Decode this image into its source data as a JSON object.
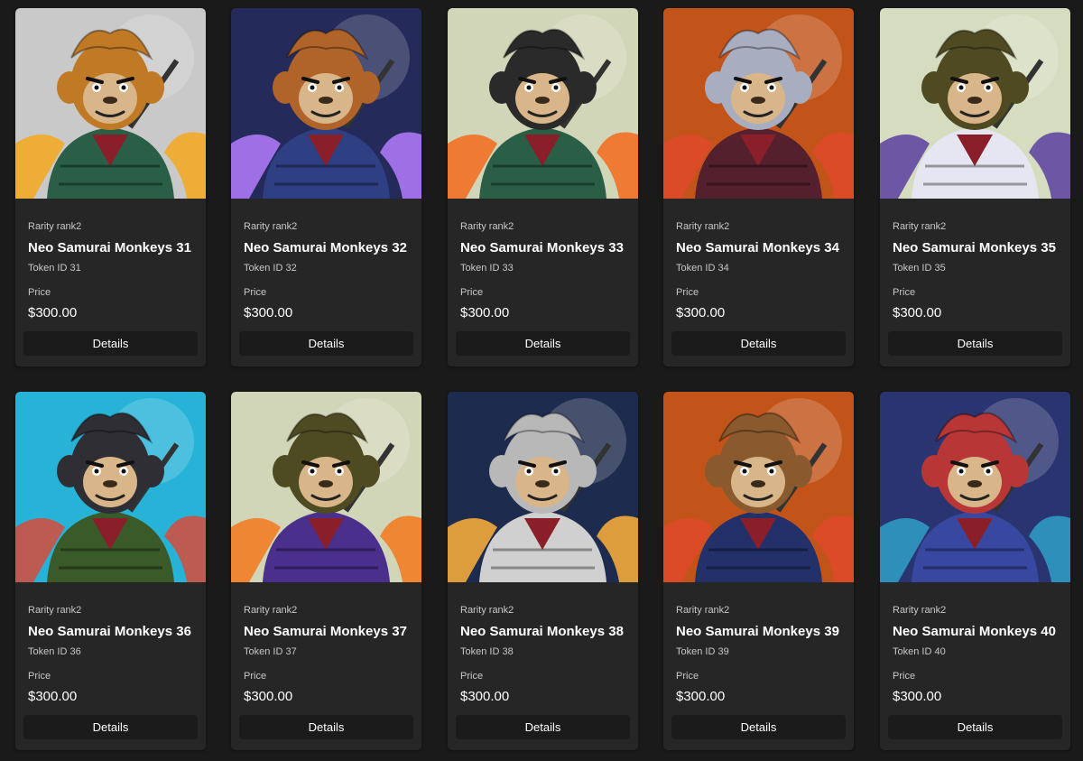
{
  "rarity_label": "Rarity rank2",
  "price_label": "Price",
  "details_label": "Details",
  "cards": [
    {
      "name": "Neo Samurai Monkeys 31",
      "token": "Token ID 31",
      "price": "$300.00",
      "bg": "#c9c9c9",
      "fur": "#c07a25",
      "outfit": "#2a5e46",
      "accent": "#f3a81c"
    },
    {
      "name": "Neo Samurai Monkeys 32",
      "token": "Token ID 32",
      "price": "$300.00",
      "bg": "#242a5a",
      "fur": "#b0642a",
      "outfit": "#2f3f83",
      "accent": "#b57bff"
    },
    {
      "name": "Neo Samurai Monkeys 33",
      "token": "Token ID 33",
      "price": "$300.00",
      "bg": "#d2d6b8",
      "fur": "#2a2a2a",
      "outfit": "#2a5e46",
      "accent": "#f36a1c"
    },
    {
      "name": "Neo Samurai Monkeys 34",
      "token": "Token ID 34",
      "price": "$300.00",
      "bg": "#c2541a",
      "fur": "#a9adc0",
      "outfit": "#55202e",
      "accent": "#e04a2a"
    },
    {
      "name": "Neo Samurai Monkeys 35",
      "token": "Token ID 35",
      "price": "$300.00",
      "bg": "#d6dcc0",
      "fur": "#4f4a22",
      "outfit": "#e6e6f2",
      "accent": "#5b3fa0"
    },
    {
      "name": "Neo Samurai Monkeys 36",
      "token": "Token ID 36",
      "price": "$300.00",
      "bg": "#27b3d8",
      "fur": "#2e2e34",
      "outfit": "#3b5a2a",
      "accent": "#d84a3a"
    },
    {
      "name": "Neo Samurai Monkeys 37",
      "token": "Token ID 37",
      "price": "$300.00",
      "bg": "#d2d6b8",
      "fur": "#4e4a22",
      "outfit": "#4a2f8c",
      "accent": "#f3781c"
    },
    {
      "name": "Neo Samurai Monkeys 38",
      "token": "Token ID 38",
      "price": "$300.00",
      "bg": "#1d2b4e",
      "fur": "#b8b8b8",
      "outfit": "#d0d0d0",
      "accent": "#ffb23a"
    },
    {
      "name": "Neo Samurai Monkeys 39",
      "token": "Token ID 39",
      "price": "$300.00",
      "bg": "#c2541a",
      "fur": "#8a5a2e",
      "outfit": "#23306a",
      "accent": "#e04a2a"
    },
    {
      "name": "Neo Samurai Monkeys 40",
      "token": "Token ID 40",
      "price": "$300.00",
      "bg": "#2a3470",
      "fur": "#b83636",
      "outfit": "#3848a0",
      "accent": "#2fa0c8"
    }
  ]
}
